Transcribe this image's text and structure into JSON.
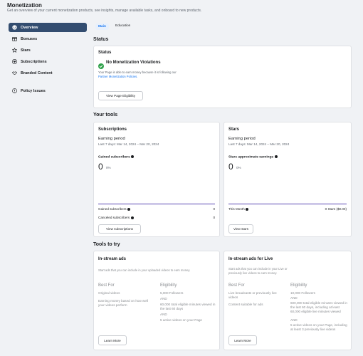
{
  "header": {
    "title": "Monetization",
    "subtitle": "Get an overview of your current monetization products, see insights, manage available tasks, and onboard to new products."
  },
  "sidebar": {
    "items": [
      {
        "label": "Overview",
        "icon": "overview-icon"
      },
      {
        "label": "Bonuses",
        "icon": "gift-icon"
      },
      {
        "label": "Stars",
        "icon": "stars-icon"
      },
      {
        "label": "Subscriptions",
        "icon": "heart-icon"
      },
      {
        "label": "Branded Content",
        "icon": "handshake-icon"
      },
      {
        "label": "Policy Issues",
        "icon": "alert-icon"
      }
    ]
  },
  "tabs": {
    "main": "Main",
    "education": "Education"
  },
  "status_section": {
    "heading": "Status",
    "card_title": "Status",
    "status_text": "No Monetization Violations",
    "description_line1": "Your Page is able to earn money because it is following our",
    "description_link": "Partner Monetization Policies.",
    "button": "View Page Eligibility"
  },
  "tools_section": {
    "heading": "Your tools",
    "subscriptions": {
      "title": "Subscriptions",
      "period_label": "Earning period",
      "period": "Last 7 days: Mar 14, 2024 – Mar 20, 2024",
      "metric_label": "Gained subscribers",
      "metric_value": "0",
      "metric_pct": "0%",
      "row1_label": "Gained subscribers",
      "row1_value": "0",
      "row2_label": "Canceled subscribers",
      "row2_value": "0",
      "button": "View subscriptions"
    },
    "stars": {
      "title": "Stars",
      "period_label": "Earning period",
      "period": "Last 7 days: Mar 14, 2024 – Mar 20, 2024",
      "metric_label": "Stars approximate earnings",
      "metric_value": "0",
      "metric_pct": "0%",
      "row1_label": "This Month",
      "row1_value": "0 Stars ($0.00)",
      "button": "View stars"
    }
  },
  "try_section": {
    "heading": "Tools to try",
    "instream": {
      "title": "In-stream ads",
      "description": "Start ads that you can include in your uploaded videos to earn money.",
      "best_for_h": "Best For",
      "eligibility_h": "Eligibility",
      "best_for_1": "Original videos",
      "best_for_2": "Earning money based on how well your videos perform",
      "elig_1": "5,000 Followers",
      "elig_2": "AND",
      "elig_3": "60,000 total eligible minutes viewed in the last 60 days",
      "elig_4": "AND",
      "elig_5": "5 active videos on your Page",
      "button": "Learn More"
    },
    "instream_live": {
      "title": "In-stream ads for Live",
      "description": "Start ads that you can include in your Live or previously live videos to earn money.",
      "best_for_h": "Best For",
      "eligibility_h": "Eligibility",
      "best_for_1": "Live broadcasts or previously live videos",
      "best_for_2": "Content suitable for ads",
      "elig_1": "10,000 Followers",
      "elig_2": "AND",
      "elig_3": "600,000 total eligible minutes viewed in the last 60 days, including at least 60,000 eligible live minutes viewed",
      "elig_4": "AND",
      "elig_5": "5 active videos on your Page, including at least 3 previously live videos",
      "button": "Learn More"
    }
  },
  "colors": {
    "accent": "#1877f2",
    "nav_active": "#334d70",
    "bar": "#5b48b3",
    "success": "#31a24c"
  }
}
